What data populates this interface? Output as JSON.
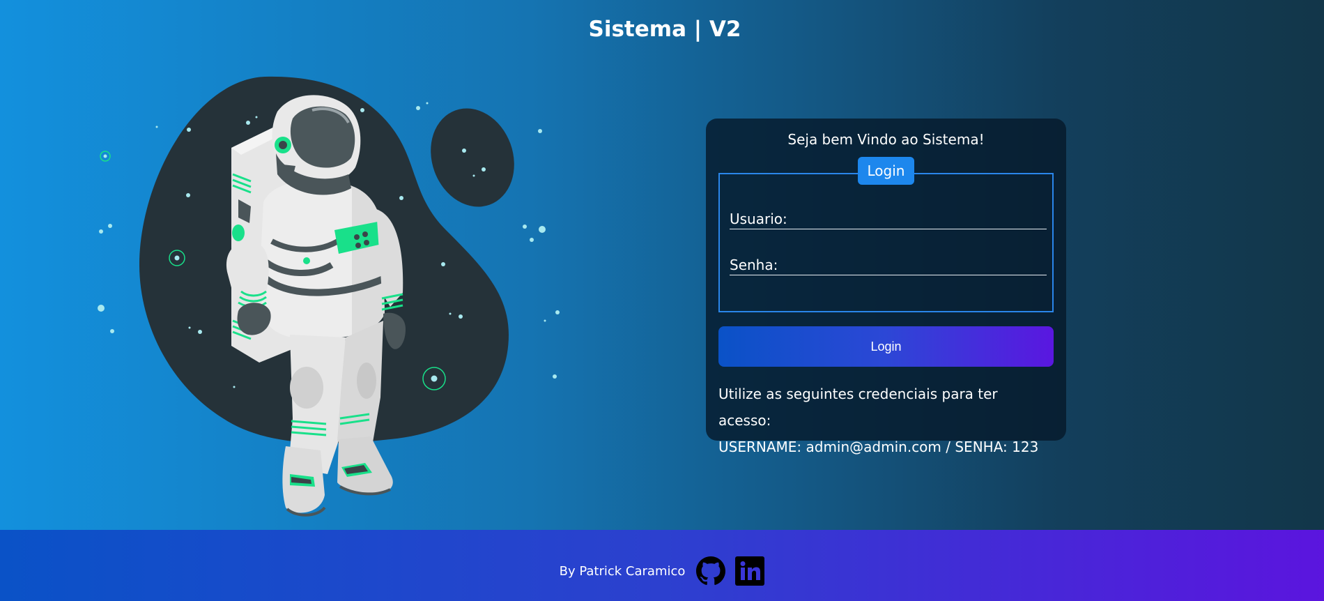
{
  "page": {
    "title": "Sistema | V2"
  },
  "login": {
    "welcome": "Seja bem Vindo ao Sistema!",
    "legend": "Login",
    "username_label": "Usuario:",
    "password_label": "Senha:",
    "submit_label": "Login",
    "info_line1": "Utilize as seguintes credenciais para ter acesso:",
    "info_line2": "USERNAME: admin@admin.com / SENHA: 123"
  },
  "footer": {
    "credit": "By Patrick Caramico",
    "icons": [
      "github-icon",
      "linkedin-icon"
    ]
  },
  "colors": {
    "accent": "#1d87ed",
    "card_bg": "#061a2b",
    "button_start": "#0a52c7",
    "button_end": "#5a17e0"
  }
}
